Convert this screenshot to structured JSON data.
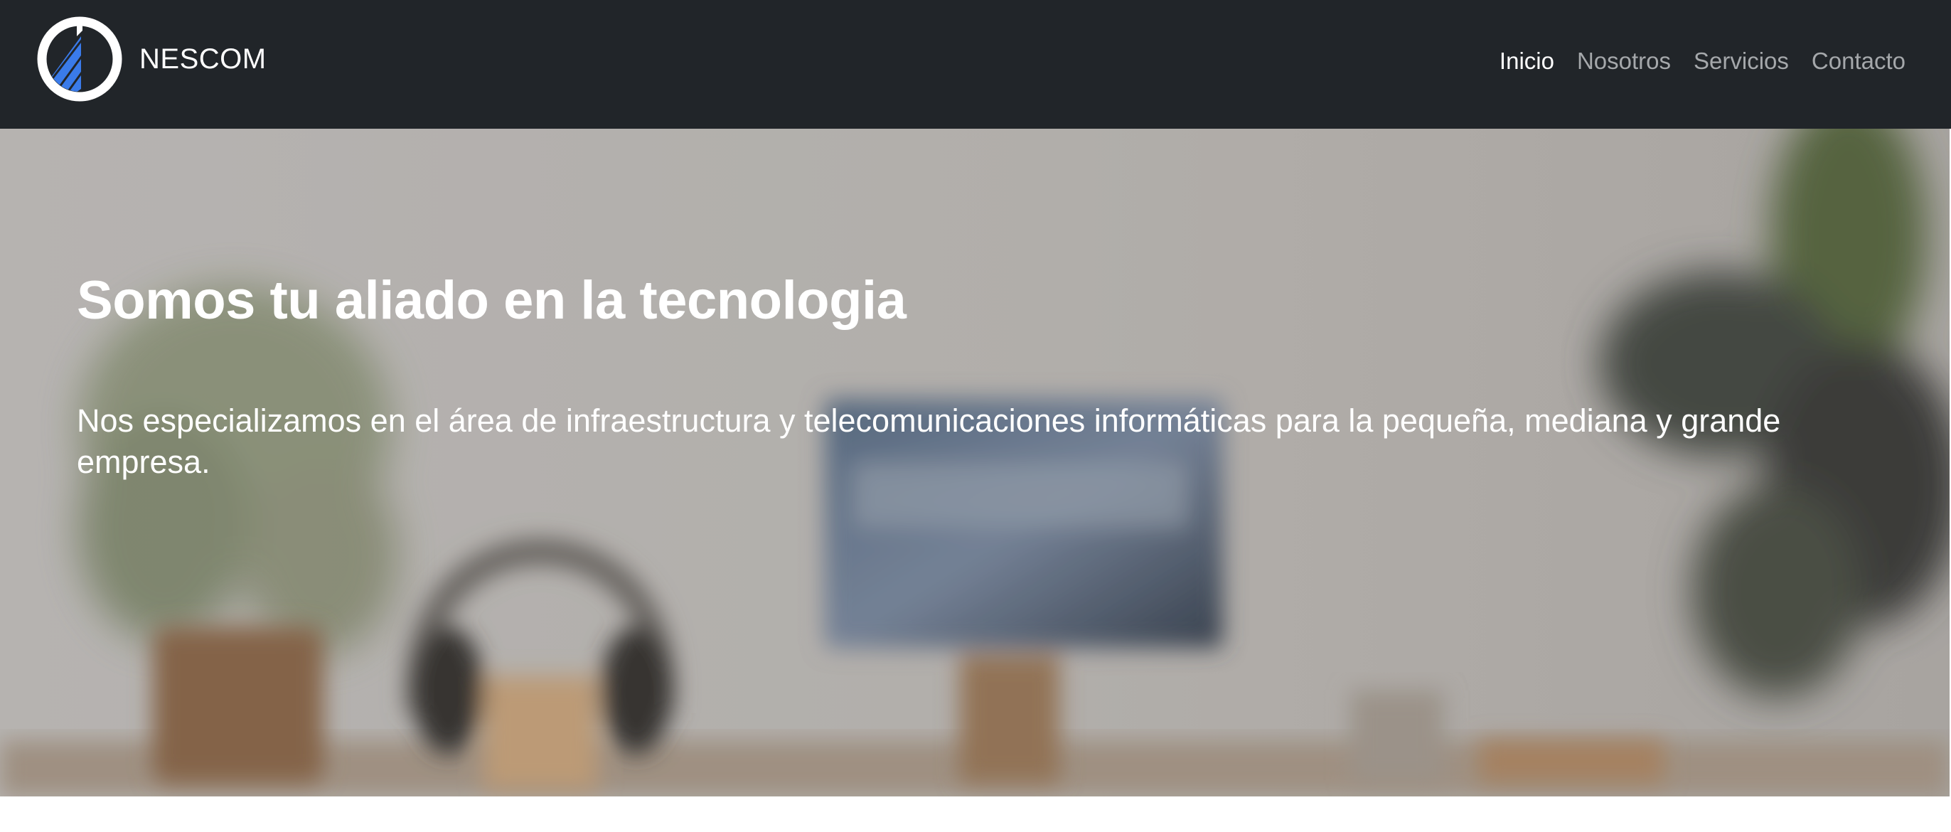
{
  "brand": {
    "name": "NESCOM",
    "logo_icon": "circle-arrow-logo-icon",
    "logo_color": "#3a7bea"
  },
  "nav": {
    "items": [
      {
        "label": "Inicio",
        "active": true
      },
      {
        "label": "Nosotros",
        "active": false
      },
      {
        "label": "Servicios",
        "active": false
      },
      {
        "label": "Contacto",
        "active": false
      }
    ]
  },
  "hero": {
    "title": "Somos tu aliado en la tecnologia",
    "description": "Nos especializamos en el área de infraestructura y telecomunicaciones informáticas para la pequeña, mediana y grande empresa."
  },
  "colors": {
    "navbar_bg": "#212529",
    "nav_active": "#ffffff",
    "nav_inactive": "#a5a8ab"
  }
}
